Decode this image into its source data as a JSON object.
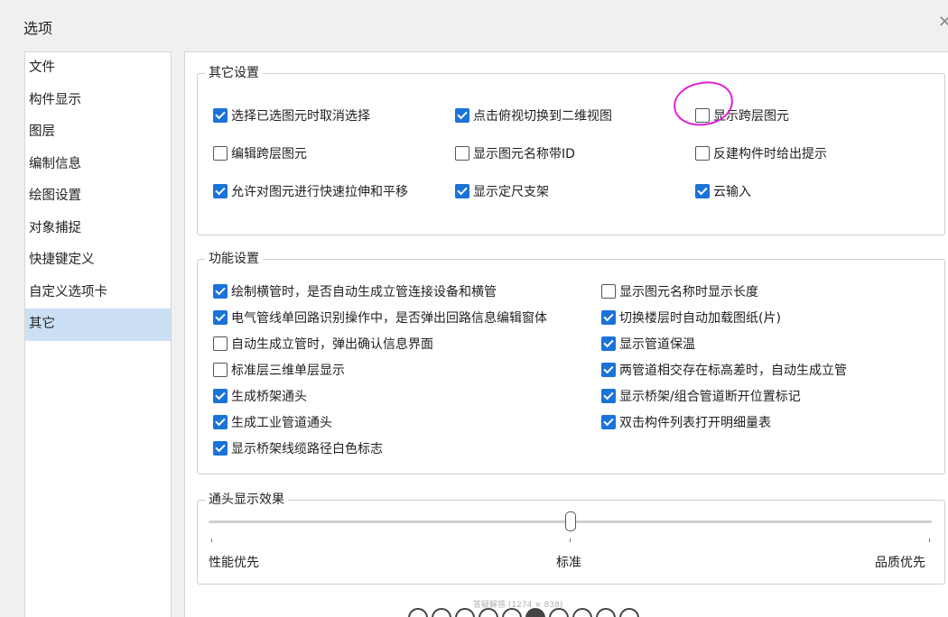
{
  "dialog": {
    "title": "选项"
  },
  "sidebar": {
    "items": [
      {
        "label": "文件"
      },
      {
        "label": "构件显示"
      },
      {
        "label": "图层"
      },
      {
        "label": "编制信息"
      },
      {
        "label": "绘图设置"
      },
      {
        "label": "对象捕捉"
      },
      {
        "label": "快捷键定义"
      },
      {
        "label": "自定义选项卡"
      },
      {
        "label": "其它",
        "selected": true
      }
    ]
  },
  "other_settings": {
    "legend": "其它设置",
    "options": [
      {
        "label": "选择已选图元时取消选择",
        "checked": true
      },
      {
        "label": "点击俯视切换到二维视图",
        "checked": true
      },
      {
        "label": "显示跨层图元",
        "checked": false
      },
      {
        "label": "编辑跨层图元",
        "checked": false
      },
      {
        "label": "显示图元名称带ID",
        "checked": false
      },
      {
        "label": "反建构件时给出提示",
        "checked": false
      },
      {
        "label": "允许对图元进行快速拉伸和平移",
        "checked": true
      },
      {
        "label": "显示定尺支架",
        "checked": true
      },
      {
        "label": "云输入",
        "checked": true
      }
    ]
  },
  "function_settings": {
    "legend": "功能设置",
    "options": [
      {
        "label": "绘制横管时，是否自动生成立管连接设备和横管",
        "checked": true
      },
      {
        "label": "显示图元名称时显示长度",
        "checked": false
      },
      {
        "label": "电气管线单回路识别操作中，是否弹出回路信息编辑窗体",
        "checked": true
      },
      {
        "label": "切换楼层时自动加载图纸(片)",
        "checked": true
      },
      {
        "label": "自动生成立管时，弹出确认信息界面",
        "checked": false
      },
      {
        "label": "显示管道保温",
        "checked": true
      },
      {
        "label": "标准层三维单层显示",
        "checked": false
      },
      {
        "label": "两管道相交存在标高差时，自动生成立管",
        "checked": true
      },
      {
        "label": "生成桥架通头",
        "checked": true
      },
      {
        "label": "显示桥架/组合管道断开位置标记",
        "checked": true
      },
      {
        "label": "生成工业管道通头",
        "checked": true
      },
      {
        "label": "双击构件列表打开明细量表",
        "checked": true
      },
      {
        "label": "显示桥架线缆路径白色标志",
        "checked": true
      }
    ]
  },
  "fitting_display": {
    "legend": "通头显示效果",
    "slider_value": 0.5,
    "labels": {
      "left": "性能优先",
      "middle": "标准",
      "right": "品质优先"
    }
  },
  "footer": {
    "caption": "答疑解惑 (1274 × 838)"
  },
  "colors": {
    "accent": "#1a73d8",
    "selection": "#cce0f5",
    "annotation": "#e020d8"
  }
}
